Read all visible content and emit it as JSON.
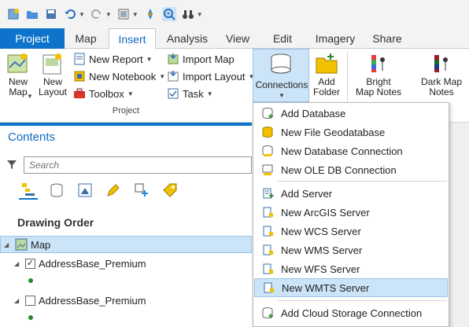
{
  "qat": {
    "icons": [
      "new-project-icon",
      "open-project-icon",
      "save-project-icon",
      "undo-icon",
      "redo-icon",
      "view-icon",
      "navigate-icon",
      "zoom-icon",
      "binoculars-icon",
      "customize-icon"
    ]
  },
  "tabs": [
    {
      "label": "Project"
    },
    {
      "label": "Map"
    },
    {
      "label": "Insert"
    },
    {
      "label": "Analysis"
    },
    {
      "label": "View"
    },
    {
      "label": "Edit"
    },
    {
      "label": "Imagery"
    },
    {
      "label": "Share"
    }
  ],
  "ribbon": {
    "new_map": "New\nMap",
    "new_layout": "New\nLayout",
    "new_report": "New Report",
    "new_notebook": "New Notebook",
    "toolbox": "Toolbox",
    "import_map": "Import Map",
    "import_layout": "Import Layout",
    "task": "Task",
    "connections": "Connections",
    "add_folder": "Add\nFolder",
    "bright_map_notes": "Bright\nMap Notes",
    "dark_map_notes": "Dark Map\nNotes",
    "project_group": "Project"
  },
  "contents": {
    "title": "Contents",
    "search_placeholder": "Search",
    "drawing_order": "Drawing Order",
    "map_label": "Map",
    "layer1": "AddressBase_Premium",
    "layer2": "AddressBase_Premium"
  },
  "menu": {
    "items": [
      {
        "label": "Add Database"
      },
      {
        "label": "New File Geodatabase"
      },
      {
        "label": "New Database Connection"
      },
      {
        "label": "New OLE DB Connection"
      },
      {
        "label": "Add Server"
      },
      {
        "label": "New ArcGIS Server"
      },
      {
        "label": "New WCS Server"
      },
      {
        "label": "New WMS Server"
      },
      {
        "label": "New WFS Server"
      },
      {
        "label": "New WMTS Server"
      },
      {
        "label": "Add Cloud Storage Connection"
      }
    ]
  },
  "colors": {
    "accent": "#0e74cb",
    "selection": "#cce4f7"
  }
}
